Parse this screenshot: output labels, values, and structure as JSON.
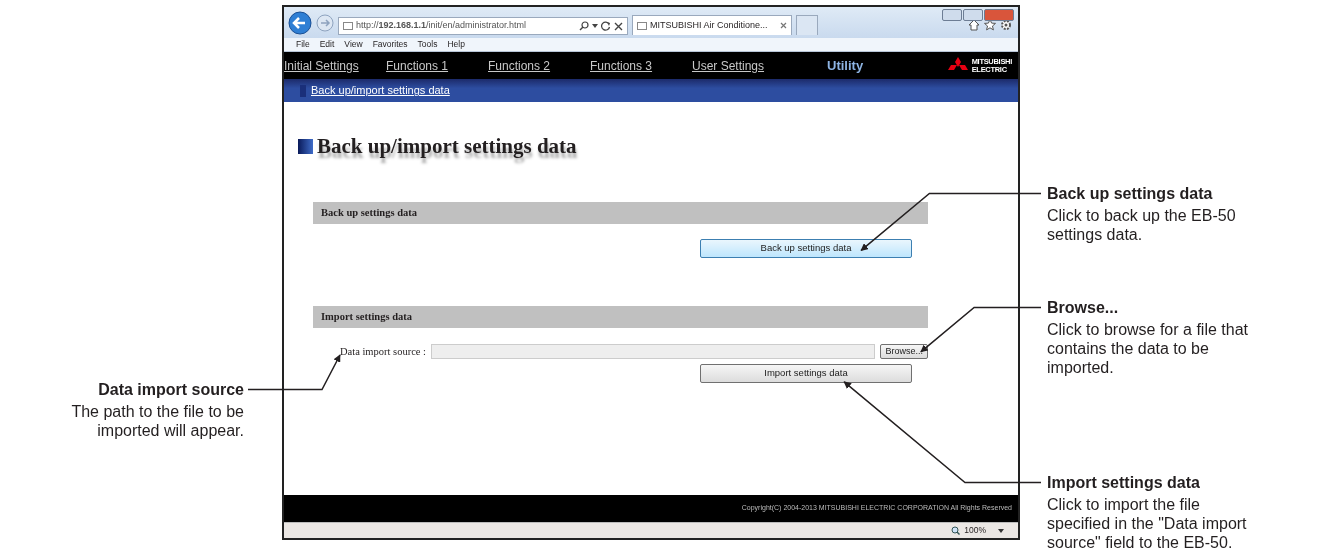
{
  "browser": {
    "address": "http://**192.168.1.1**/init/en/administrator.html",
    "tab_title": "MITSUBISHI Air Conditione...",
    "menu": [
      "File",
      "Edit",
      "View",
      "Favorites",
      "Tools",
      "Help"
    ],
    "zoom": "100%"
  },
  "page": {
    "nav": [
      {
        "label": "Initial Settings",
        "selected": false
      },
      {
        "label": "Functions 1",
        "selected": false
      },
      {
        "label": "Functions 2",
        "selected": false
      },
      {
        "label": "Functions 3",
        "selected": false
      },
      {
        "label": "User Settings",
        "selected": false
      },
      {
        "label": "Utility",
        "selected": true
      }
    ],
    "logo": [
      "MITSUBISHI",
      "ELECTRIC"
    ],
    "breadcrumb": "Back up/import settings data",
    "title": "Back up/import settings data",
    "sections": [
      {
        "kind": "backup",
        "heading": "Back up settings data",
        "button": "Back up settings data"
      },
      {
        "kind": "import",
        "heading": "Import settings data",
        "field_label": "Data import source :",
        "browse_button": "Browse...",
        "button": "Import settings data"
      }
    ],
    "footer": "Copyright(C) 2004-2013 MITSUBISHI ELECTRIC CORPORATION All Rights Reserved"
  },
  "callouts": [
    {
      "kind": "right",
      "title": "Back up settings data",
      "text": "Click to back up the EB-50 settings data."
    },
    {
      "kind": "right",
      "title": "Browse...",
      "text": "Click to browse for a file that contains the data to be imported."
    },
    {
      "kind": "left",
      "title": "Data import source",
      "text": "The path to the file to be imported will appear."
    },
    {
      "kind": "right",
      "title": "Import settings data",
      "text": "Click to import the file specified in the \"Data import source\" field to the EB-50."
    }
  ]
}
